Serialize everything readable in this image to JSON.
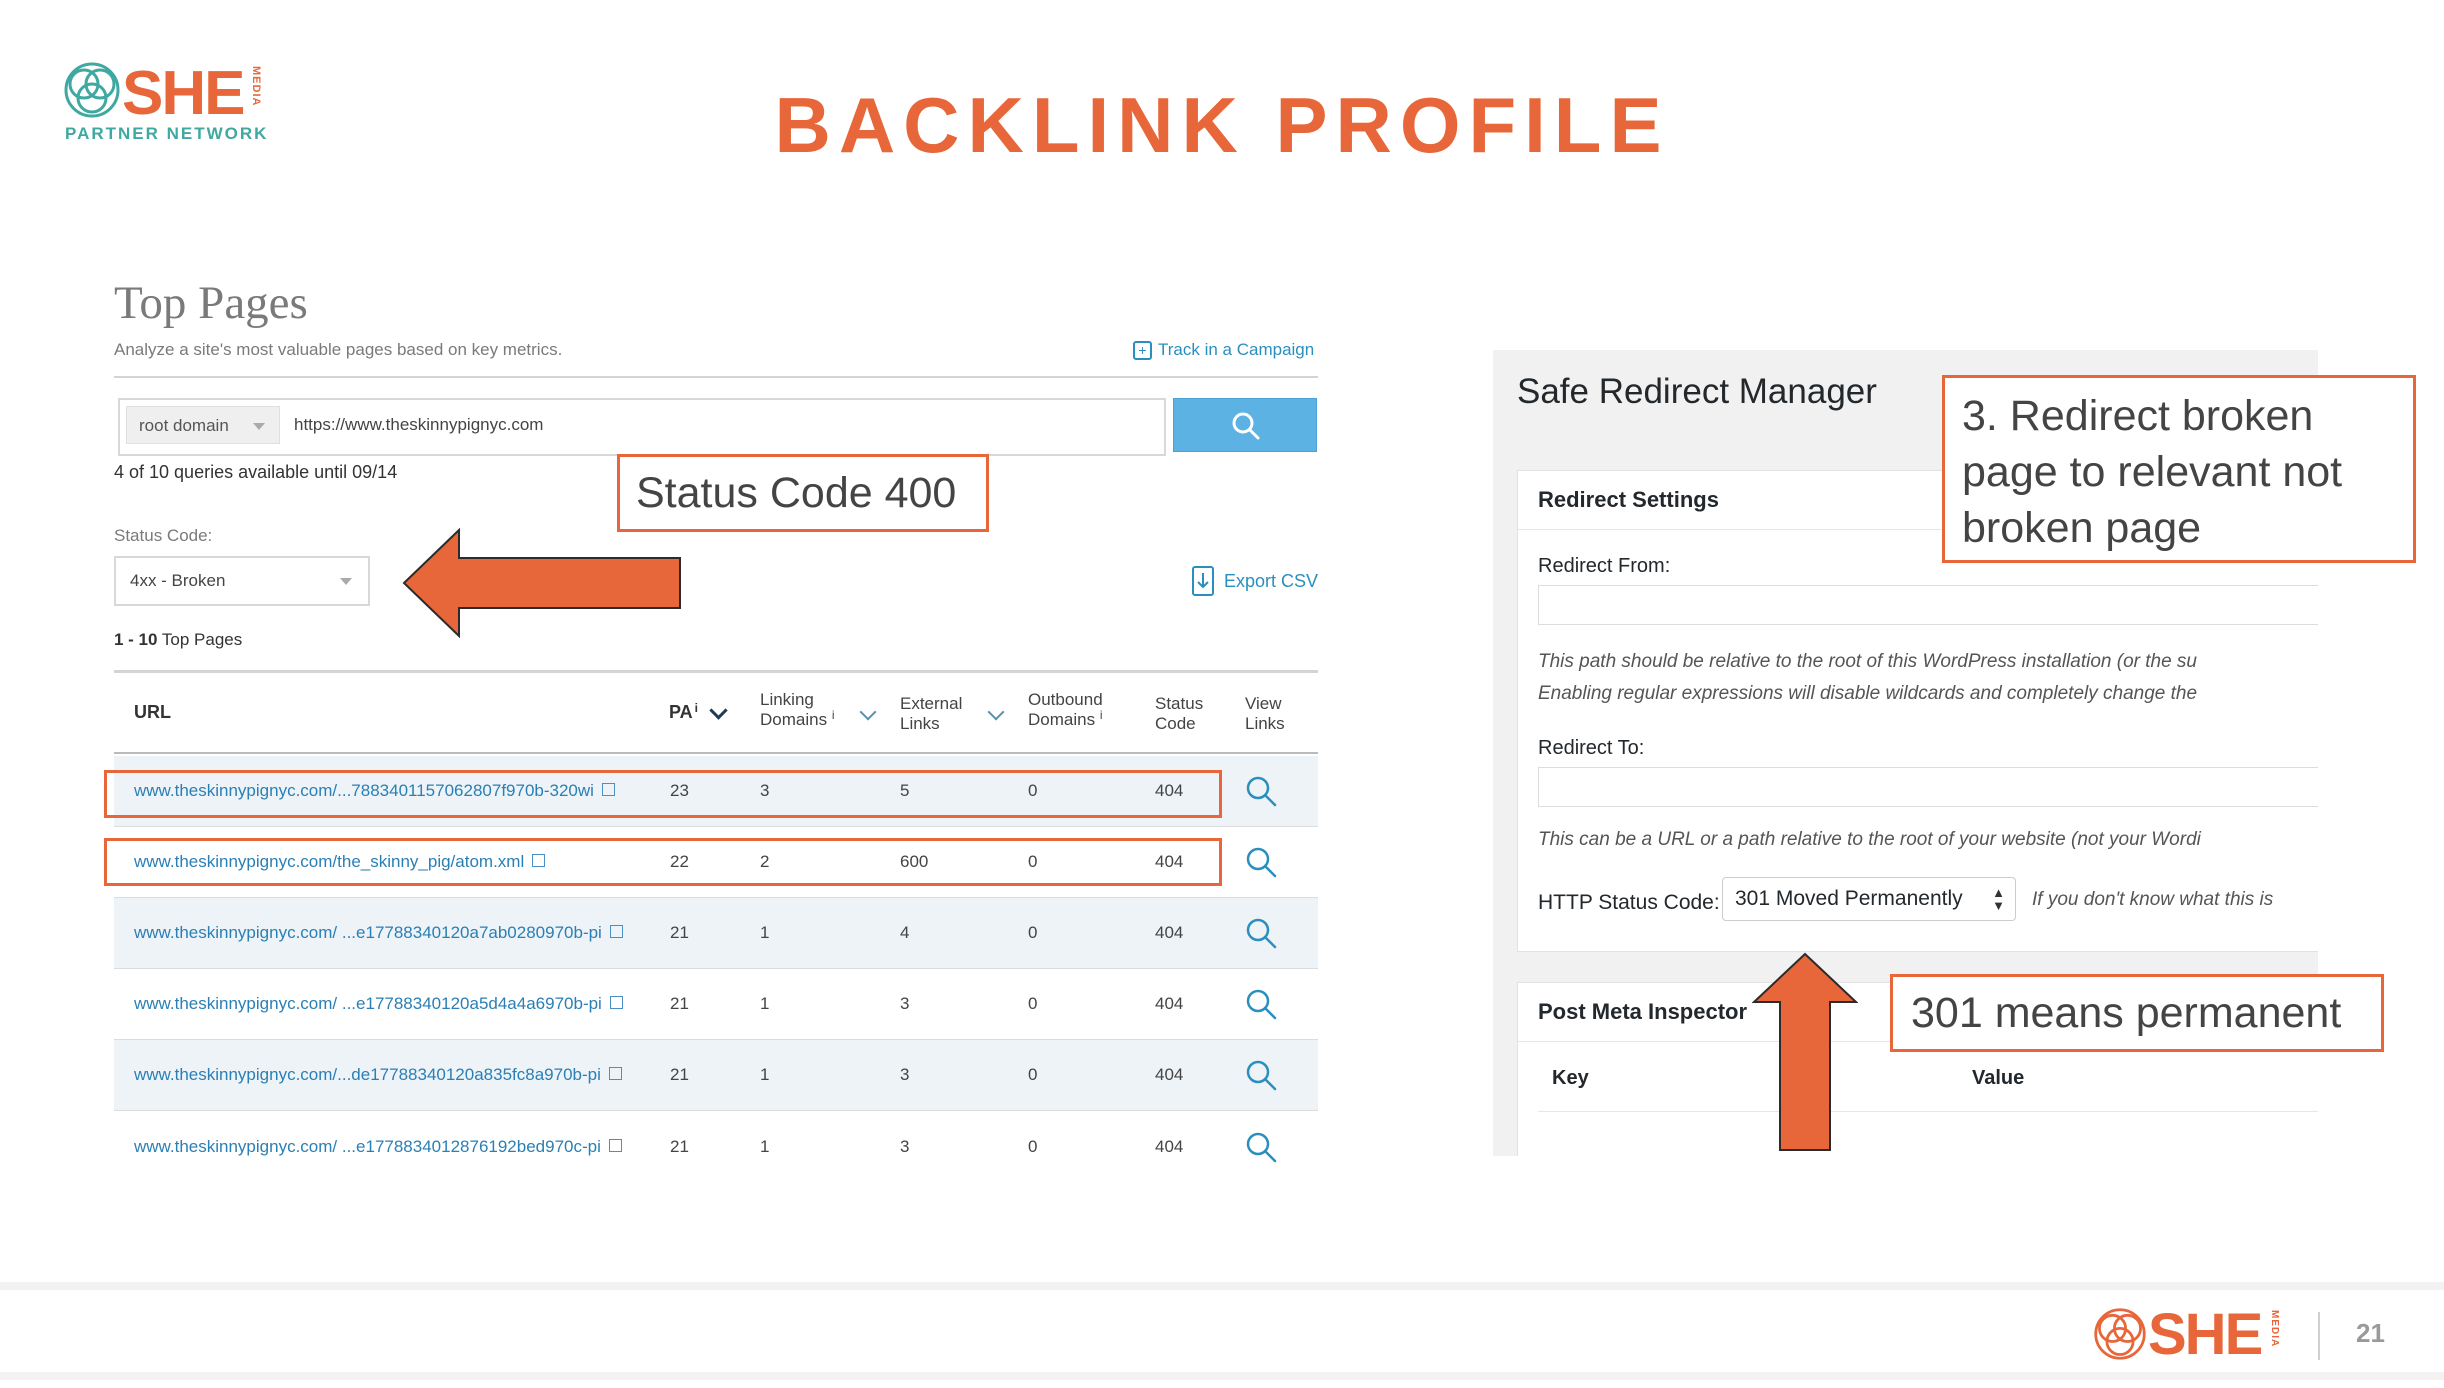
{
  "logo": {
    "brand": "SHE",
    "media": "MEDIA",
    "tagline": "PARTNER NETWORK"
  },
  "slide": {
    "title": "BACKLINK PROFILE",
    "page_number": "21"
  },
  "top_pages": {
    "title": "Top Pages",
    "subtitle": "Analyze a site's most valuable pages based on key metrics.",
    "track_label": "Track in a Campaign",
    "scope_select": "root domain",
    "url_value": "https://www.theskinnypignyc.com",
    "queries_text": "4 of 10 queries available until 09/14",
    "status_label": "Status Code:",
    "status_value": "4xx - Broken",
    "export_label": "Export CSV",
    "range_bold": "1 - 10",
    "range_text": "Top Pages",
    "columns": {
      "url": "URL",
      "pa": "PA",
      "info": "i",
      "linking_1": "Linking",
      "linking_2": "Domains",
      "external_1": "External",
      "external_2": "Links",
      "outbound_1": "Outbound",
      "outbound_2": "Domains",
      "status_1": "Status",
      "status_2": "Code",
      "view_1": "View",
      "view_2": "Links"
    },
    "rows": [
      {
        "url": "www.theskinnypignyc.com/...7883401157062807f970b-320wi",
        "pa": "23",
        "linking": "3",
        "external": "5",
        "outbound": "0",
        "status": "404"
      },
      {
        "url": "www.theskinnypignyc.com/the_skinny_pig/atom.xml",
        "pa": "22",
        "linking": "2",
        "external": "600",
        "outbound": "0",
        "status": "404"
      },
      {
        "url": "www.theskinnypignyc.com/ ...e17788340120a7ab0280970b-pi",
        "pa": "21",
        "linking": "1",
        "external": "4",
        "outbound": "0",
        "status": "404"
      },
      {
        "url": "www.theskinnypignyc.com/ ...e17788340120a5d4a4a6970b-pi",
        "pa": "21",
        "linking": "1",
        "external": "3",
        "outbound": "0",
        "status": "404"
      },
      {
        "url": "www.theskinnypignyc.com/...de17788340120a835fc8a970b-pi",
        "pa": "21",
        "linking": "1",
        "external": "3",
        "outbound": "0",
        "status": "404"
      },
      {
        "url": "www.theskinnypignyc.com/ ...e1778834012876192bed970c-pi",
        "pa": "21",
        "linking": "1",
        "external": "3",
        "outbound": "0",
        "status": "404"
      }
    ]
  },
  "annotations": {
    "status_code": "Status Code 400",
    "redirect_line1": "3. Redirect broken",
    "redirect_line2": "page to relevant not",
    "redirect_line3": "broken page",
    "permanent": "301 means permanent",
    "accent_color": "#e8673a"
  },
  "redirect_manager": {
    "title": "Safe Redirect Manager",
    "settings_title": "Redirect Settings",
    "from_label": "Redirect From:",
    "from_desc_1": "This path should be relative to the root of this WordPress installation (or the su",
    "from_desc_2": "Enabling regular expressions will disable wildcards and completely change the",
    "to_label": "Redirect To:",
    "to_desc": "This can be a URL or a path relative to the root of your website (not your Wordi",
    "status_label": "HTTP Status Code:",
    "status_value": "301 Moved Permanently",
    "status_hint": "If you don't know what this is",
    "meta_title": "Post Meta Inspector",
    "key_label": "Key",
    "value_label": "Value"
  }
}
